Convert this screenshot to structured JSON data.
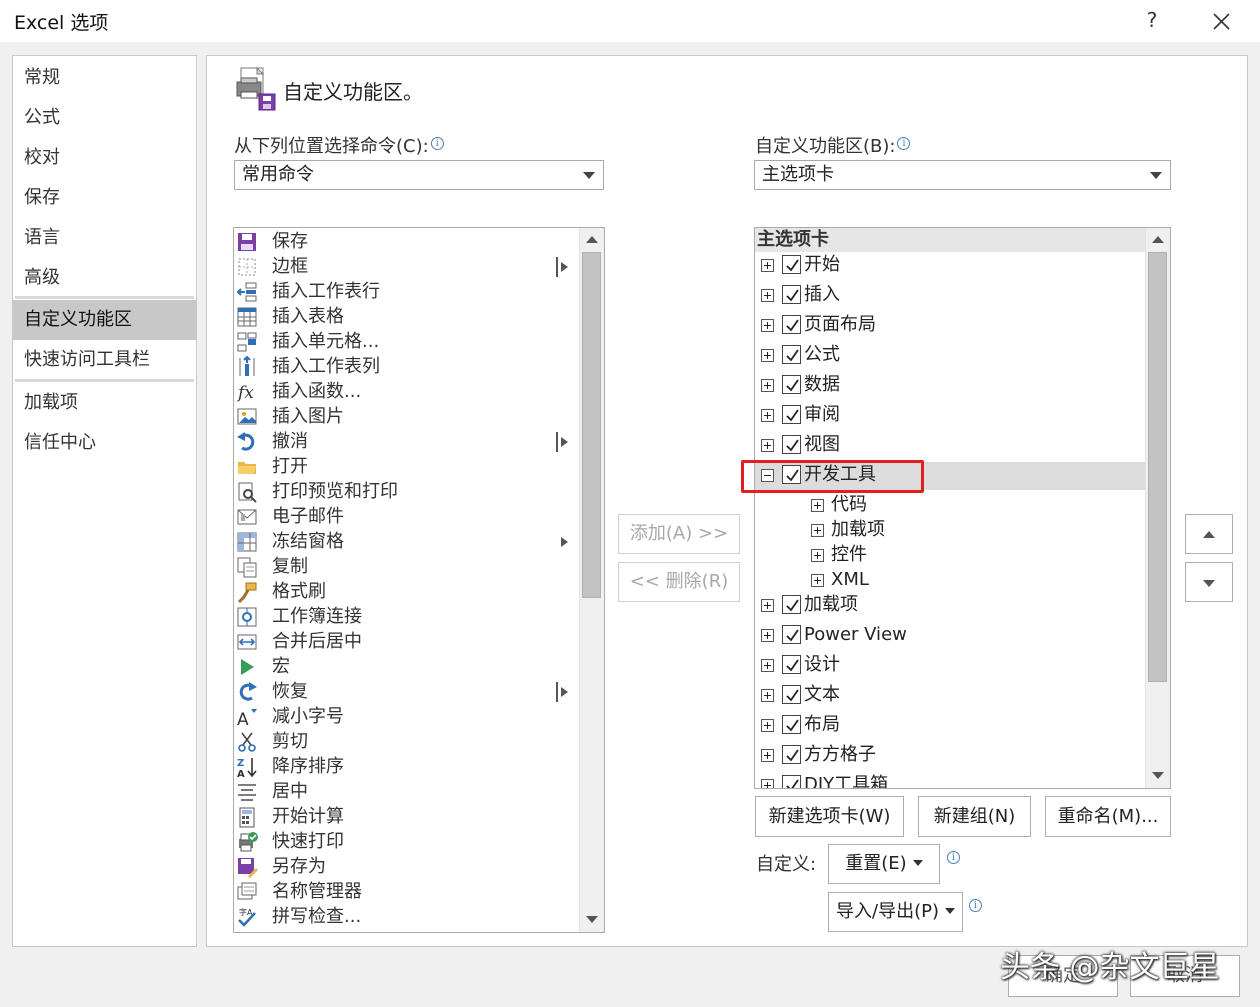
{
  "window": {
    "title": "Excel 选项",
    "help_label": "?"
  },
  "sidebar": {
    "items": [
      {
        "label": "常规"
      },
      {
        "label": "公式"
      },
      {
        "label": "校对"
      },
      {
        "label": "保存"
      },
      {
        "label": "语言"
      },
      {
        "label": "高级"
      },
      {
        "label": "自定义功能区",
        "selected": true
      },
      {
        "label": "快速访问工具栏"
      },
      {
        "label": "加载项"
      },
      {
        "label": "信任中心"
      }
    ]
  },
  "content": {
    "heading": "自定义功能区。",
    "left": {
      "label": "从下列位置选择命令(C):",
      "combo_value": "常用命令",
      "commands": [
        {
          "label": "保存",
          "icon": "save-icon"
        },
        {
          "label": "边框",
          "icon": "border-icon",
          "submenu": true
        },
        {
          "label": "插入工作表行",
          "icon": "insert-row-icon"
        },
        {
          "label": "插入表格",
          "icon": "insert-table-icon"
        },
        {
          "label": "插入单元格...",
          "icon": "insert-cells-icon"
        },
        {
          "label": "插入工作表列",
          "icon": "insert-column-icon"
        },
        {
          "label": "插入函数...",
          "icon": "function-icon"
        },
        {
          "label": "插入图片",
          "icon": "picture-icon"
        },
        {
          "label": "撤消",
          "icon": "undo-icon",
          "submenu": true
        },
        {
          "label": "打开",
          "icon": "folder-icon"
        },
        {
          "label": "打印预览和打印",
          "icon": "print-preview-icon"
        },
        {
          "label": "电子邮件",
          "icon": "email-icon"
        },
        {
          "label": "冻结窗格",
          "icon": "freeze-panes-icon",
          "submenu": true
        },
        {
          "label": "复制",
          "icon": "copy-icon"
        },
        {
          "label": "格式刷",
          "icon": "format-painter-icon"
        },
        {
          "label": "工作簿连接",
          "icon": "connections-icon"
        },
        {
          "label": "合并后居中",
          "icon": "merge-center-icon"
        },
        {
          "label": "宏",
          "icon": "macro-icon"
        },
        {
          "label": "恢复",
          "icon": "redo-icon",
          "submenu": true
        },
        {
          "label": "减小字号",
          "icon": "decrease-font-icon"
        },
        {
          "label": "剪切",
          "icon": "cut-icon"
        },
        {
          "label": "降序排序",
          "icon": "sort-descending-icon"
        },
        {
          "label": "居中",
          "icon": "align-center-icon"
        },
        {
          "label": "开始计算",
          "icon": "calculator-icon"
        },
        {
          "label": "快速打印",
          "icon": "quick-print-icon"
        },
        {
          "label": "另存为",
          "icon": "save-as-icon"
        },
        {
          "label": "名称管理器",
          "icon": "name-manager-icon"
        },
        {
          "label": "拼写检查...",
          "icon": "spelling-icon"
        }
      ]
    },
    "middle": {
      "add_label": "添加(A) >>",
      "remove_label": "<< 删除(R)"
    },
    "right": {
      "label": "自定义功能区(B):",
      "combo_value": "主选项卡",
      "tree_header": "主选项卡",
      "tabs": [
        {
          "label": "开始",
          "checked": true
        },
        {
          "label": "插入",
          "checked": true
        },
        {
          "label": "页面布局",
          "checked": true
        },
        {
          "label": "公式",
          "checked": true
        },
        {
          "label": "数据",
          "checked": true
        },
        {
          "label": "审阅",
          "checked": true
        },
        {
          "label": "视图",
          "checked": true
        },
        {
          "label": "开发工具",
          "checked": true,
          "expanded": true,
          "highlighted": true,
          "groups": [
            {
              "label": "代码"
            },
            {
              "label": "加载项"
            },
            {
              "label": "控件"
            },
            {
              "label": "XML"
            }
          ]
        },
        {
          "label": "加载项",
          "checked": true
        },
        {
          "label": "Power View",
          "checked": true
        },
        {
          "label": "设计",
          "checked": true
        },
        {
          "label": "文本",
          "checked": true
        },
        {
          "label": "布局",
          "checked": true
        },
        {
          "label": "方方格子",
          "checked": true
        },
        {
          "label": "DIY工具箱",
          "checked": true
        }
      ],
      "new_tab_label": "新建选项卡(W)",
      "new_group_label": "新建组(N)",
      "rename_label": "重命名(M)...",
      "customize_label": "自定义:",
      "reset_label": "重置(E)",
      "import_export_label": "导入/导出(P)"
    },
    "footer": {
      "ok_label": "确定",
      "cancel_label": "取消"
    }
  },
  "watermark": "头条 @杂文巨星",
  "colors": {
    "highlight_box": "#e02020",
    "selected_nav": "#c8c8c8",
    "accent_blue": "#2f6fba"
  }
}
